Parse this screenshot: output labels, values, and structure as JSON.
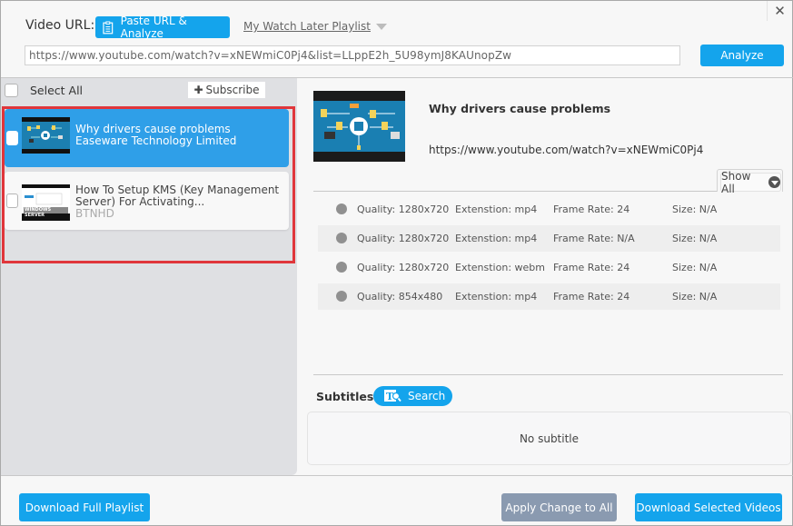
{
  "header": {
    "close_icon": "close-icon",
    "url_label": "Video URL:",
    "paste_button": "Paste URL & Analyze",
    "paste_icon": "clipboard-icon",
    "watch_later_link": "My Watch Later Playlist",
    "url_input_value": "https://www.youtube.com/watch?v=xNEWmiC0Pj4&list=LLppE2h_5U98ymJ8KAUnopZw",
    "analyze_button": "Analyze"
  },
  "playlist": {
    "select_all_label": "Select All",
    "subscribe_label": "Subscribe",
    "items": [
      {
        "title": "Why drivers cause problems",
        "channel": "Easeware Technology Limited",
        "selected": true
      },
      {
        "title_line1": "How To Setup KMS (Key Management",
        "title_line2": "Server) For Activating...",
        "channel": "BTNHD",
        "selected": false,
        "thumb_caption": "WINDOWS SERVER"
      }
    ],
    "highlight_color": "#e0363b"
  },
  "details": {
    "title": "Why drivers cause problems",
    "url": "https://www.youtube.com/watch?v=xNEWmiC0Pj4",
    "show_all_label": "Show All",
    "formats": [
      {
        "quality": "Quality: 1280x720",
        "extension": "Extenstion: mp4",
        "frame_rate": "Frame Rate: 24",
        "size": "Size: N/A"
      },
      {
        "quality": "Quality: 1280x720",
        "extension": "Extenstion: mp4",
        "frame_rate": "Frame Rate: N/A",
        "size": "Size: N/A"
      },
      {
        "quality": "Quality: 1280x720",
        "extension": "Extenstion: webm",
        "frame_rate": "Frame Rate: 24",
        "size": "Size: N/A"
      },
      {
        "quality": "Quality: 854x480",
        "extension": "Extenstion: mp4",
        "frame_rate": "Frame Rate: 24",
        "size": "Size: N/A"
      }
    ],
    "subtitles_label": "Subtitles",
    "subtitles_search": "Search",
    "no_subtitle": "No subtitle"
  },
  "footer": {
    "download_full": "Download Full Playlist",
    "apply_change": "Apply Change to All",
    "download_selected": "Download Selected Videos"
  },
  "colors": {
    "accent": "#14a4ec",
    "selected_item": "#2f9fe8",
    "disabled_button": "#8a9ab0"
  }
}
